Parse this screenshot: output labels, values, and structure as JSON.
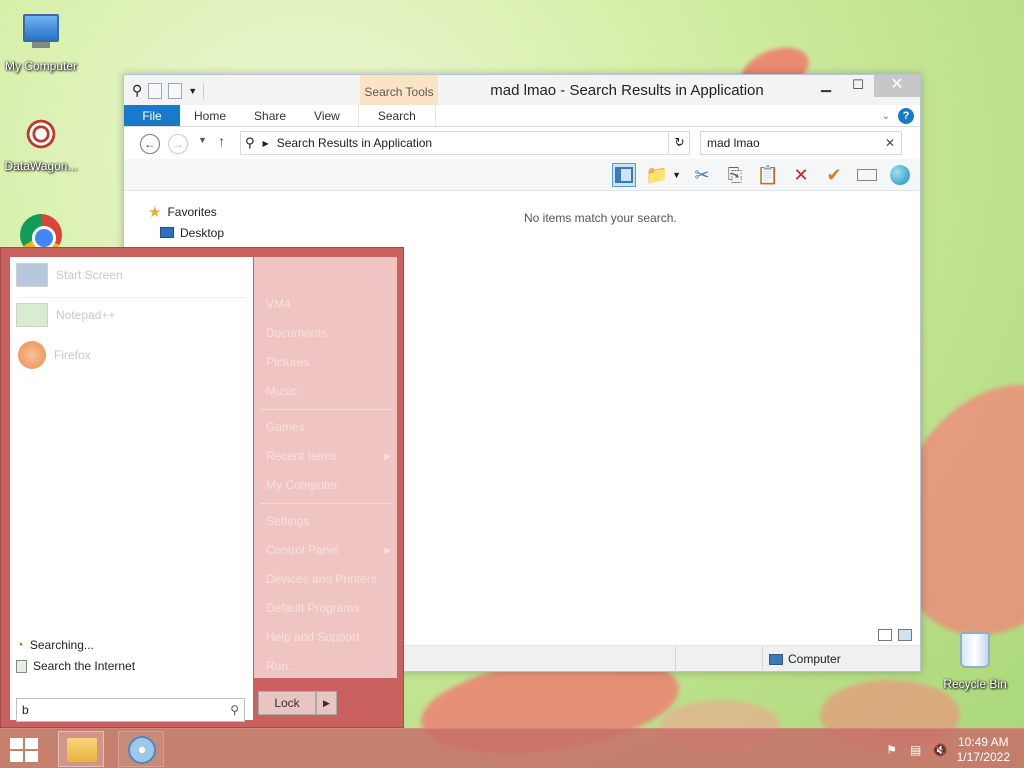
{
  "desktop": {
    "icons": [
      {
        "label": "My Computer"
      },
      {
        "label": "DataWagon..."
      },
      {
        "label": "Recycle Bin"
      }
    ]
  },
  "explorer": {
    "title": "mad lmao - Search Results in Application",
    "context_tab_group": "Search Tools",
    "ribbon_tabs": [
      "File",
      "Home",
      "Share",
      "View",
      "Search"
    ],
    "address_path": "Search Results in Application",
    "search_value": "mad lmao",
    "nav": {
      "favorites": "Favorites",
      "desktop": "Desktop"
    },
    "empty_message": "No items match your search.",
    "status_location": "Computer"
  },
  "start_menu": {
    "pinned": [
      {
        "label": "Start Screen"
      },
      {
        "label": "Notepad++"
      },
      {
        "label": "Firefox"
      }
    ],
    "search_status": "Searching...",
    "search_internet": "Search the Internet",
    "search_value": "b",
    "right_panel": [
      "VM4",
      "Documents",
      "Pictures",
      "Music",
      "Games",
      "Recent Items",
      "My Computer",
      "Settings",
      "Control Panel",
      "Devices and Printers",
      "Default Programs",
      "Help and Support",
      "Run..."
    ],
    "lock_label": "Lock"
  },
  "taskbar": {
    "time": "10:49 AM",
    "date": "1/17/2022"
  },
  "colors": {
    "accent": "#1979ca",
    "start_menu_frame": "#c9625e",
    "taskbar": "#c86e69"
  }
}
